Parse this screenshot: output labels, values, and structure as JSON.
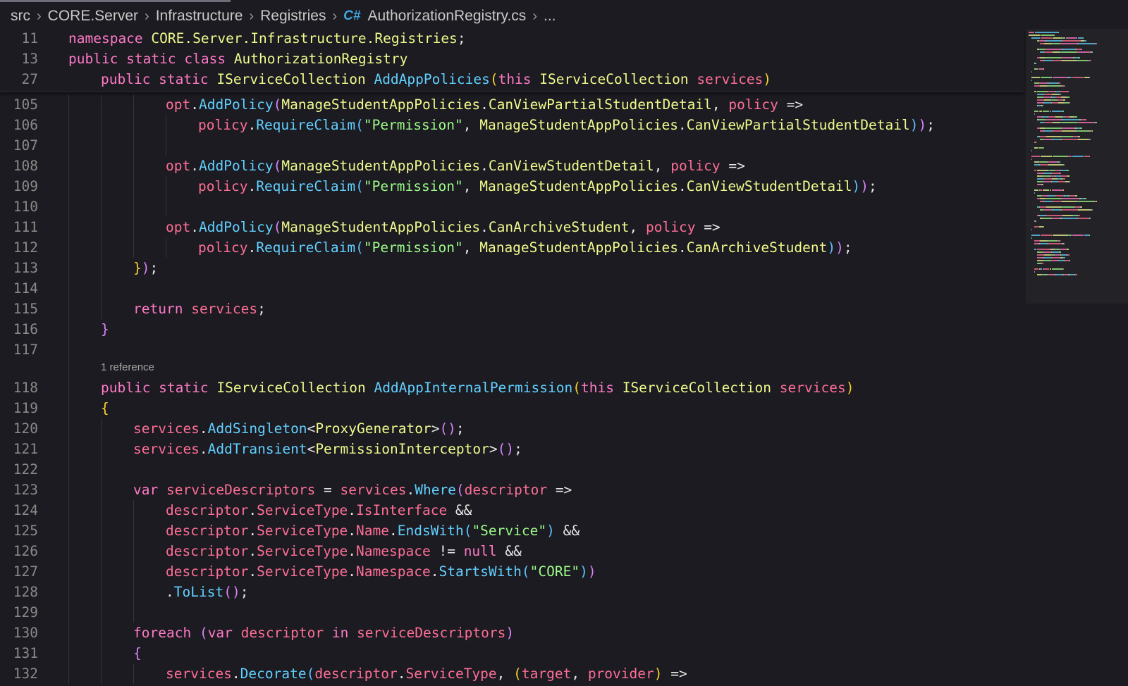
{
  "breadcrumb": {
    "items": [
      "src",
      "CORE.Server",
      "Infrastructure",
      "Registries"
    ],
    "file_icon": "C#",
    "file": "AuthorizationRegistry.cs",
    "ellipsis": "..."
  },
  "sticky": [
    {
      "ln": "11",
      "indent": 0,
      "t": [
        [
          "kw",
          "namespace"
        ],
        [
          "op",
          " "
        ],
        [
          "type",
          "CORE.Server.Infrastructure.Registries"
        ],
        [
          "op",
          ";"
        ]
      ]
    },
    {
      "ln": "13",
      "indent": 0,
      "t": [
        [
          "kw",
          "public static class"
        ],
        [
          "op",
          " "
        ],
        [
          "type",
          "AuthorizationRegistry"
        ]
      ]
    },
    {
      "ln": "27",
      "indent": 1,
      "t": [
        [
          "kw",
          "public static"
        ],
        [
          "op",
          " "
        ],
        [
          "type",
          "IServiceCollection"
        ],
        [
          "op",
          " "
        ],
        [
          "fn",
          "AddAppPolicies"
        ],
        [
          "p1",
          "("
        ],
        [
          "kw",
          "this"
        ],
        [
          "op",
          " "
        ],
        [
          "type",
          "IServiceCollection"
        ],
        [
          "op",
          " "
        ],
        [
          "var",
          "services"
        ],
        [
          "p1",
          ")"
        ]
      ]
    }
  ],
  "codelens": "1 reference",
  "lines": [
    {
      "ln": "105",
      "indent": 3,
      "t": [
        [
          "var",
          "opt"
        ],
        [
          "op",
          "."
        ],
        [
          "fn",
          "AddPolicy"
        ],
        [
          "p2",
          "("
        ],
        [
          "type",
          "ManageStudentAppPolicies"
        ],
        [
          "op",
          "."
        ],
        [
          "type",
          "CanViewPartialStudentDetail"
        ],
        [
          "op",
          ", "
        ],
        [
          "var",
          "policy"
        ],
        [
          "op",
          " =>"
        ]
      ]
    },
    {
      "ln": "106",
      "indent": 4,
      "t": [
        [
          "var",
          "policy"
        ],
        [
          "op",
          "."
        ],
        [
          "fn",
          "RequireClaim"
        ],
        [
          "p3",
          "("
        ],
        [
          "str",
          "\"Permission\""
        ],
        [
          "op",
          ", "
        ],
        [
          "type",
          "ManageStudentAppPolicies"
        ],
        [
          "op",
          "."
        ],
        [
          "type",
          "CanViewPartialStudentDetail"
        ],
        [
          "p3",
          ")"
        ],
        [
          "p2",
          ")"
        ],
        [
          "op",
          ";"
        ]
      ]
    },
    {
      "ln": "107",
      "indent": 0,
      "t": []
    },
    {
      "ln": "108",
      "indent": 3,
      "t": [
        [
          "var",
          "opt"
        ],
        [
          "op",
          "."
        ],
        [
          "fn",
          "AddPolicy"
        ],
        [
          "p2",
          "("
        ],
        [
          "type",
          "ManageStudentAppPolicies"
        ],
        [
          "op",
          "."
        ],
        [
          "type",
          "CanViewStudentDetail"
        ],
        [
          "op",
          ", "
        ],
        [
          "var",
          "policy"
        ],
        [
          "op",
          " =>"
        ]
      ]
    },
    {
      "ln": "109",
      "indent": 4,
      "t": [
        [
          "var",
          "policy"
        ],
        [
          "op",
          "."
        ],
        [
          "fn",
          "RequireClaim"
        ],
        [
          "p3",
          "("
        ],
        [
          "str",
          "\"Permission\""
        ],
        [
          "op",
          ", "
        ],
        [
          "type",
          "ManageStudentAppPolicies"
        ],
        [
          "op",
          "."
        ],
        [
          "type",
          "CanViewStudentDetail"
        ],
        [
          "p3",
          ")"
        ],
        [
          "p2",
          ")"
        ],
        [
          "op",
          ";"
        ]
      ]
    },
    {
      "ln": "110",
      "indent": 0,
      "t": []
    },
    {
      "ln": "111",
      "indent": 3,
      "t": [
        [
          "var",
          "opt"
        ],
        [
          "op",
          "."
        ],
        [
          "fn",
          "AddPolicy"
        ],
        [
          "p2",
          "("
        ],
        [
          "type",
          "ManageStudentAppPolicies"
        ],
        [
          "op",
          "."
        ],
        [
          "type",
          "CanArchiveStudent"
        ],
        [
          "op",
          ", "
        ],
        [
          "var",
          "policy"
        ],
        [
          "op",
          " =>"
        ]
      ]
    },
    {
      "ln": "112",
      "indent": 4,
      "t": [
        [
          "var",
          "policy"
        ],
        [
          "op",
          "."
        ],
        [
          "fn",
          "RequireClaim"
        ],
        [
          "p3",
          "("
        ],
        [
          "str",
          "\"Permission\""
        ],
        [
          "op",
          ", "
        ],
        [
          "type",
          "ManageStudentAppPolicies"
        ],
        [
          "op",
          "."
        ],
        [
          "type",
          "CanArchiveStudent"
        ],
        [
          "p3",
          ")"
        ],
        [
          "p2",
          ")"
        ],
        [
          "op",
          ";"
        ]
      ]
    },
    {
      "ln": "113",
      "indent": 2,
      "t": [
        [
          "p1",
          "}"
        ],
        [
          "p2",
          ")"
        ],
        [
          "op",
          ";"
        ]
      ]
    },
    {
      "ln": "114",
      "indent": 0,
      "t": []
    },
    {
      "ln": "115",
      "indent": 2,
      "t": [
        [
          "kw",
          "return"
        ],
        [
          "op",
          " "
        ],
        [
          "var",
          "services"
        ],
        [
          "op",
          ";"
        ]
      ]
    },
    {
      "ln": "116",
      "indent": 1,
      "t": [
        [
          "p2",
          "}"
        ]
      ]
    },
    {
      "ln": "117",
      "indent": 0,
      "t": []
    },
    {
      "ln": "118",
      "indent": 1,
      "codelens": true,
      "t": [
        [
          "kw",
          "public static"
        ],
        [
          "op",
          " "
        ],
        [
          "type",
          "IServiceCollection"
        ],
        [
          "op",
          " "
        ],
        [
          "fn",
          "AddAppInternalPermission"
        ],
        [
          "p1",
          "("
        ],
        [
          "kw",
          "this"
        ],
        [
          "op",
          " "
        ],
        [
          "type",
          "IServiceCollection"
        ],
        [
          "op",
          " "
        ],
        [
          "var",
          "services"
        ],
        [
          "p1",
          ")"
        ]
      ]
    },
    {
      "ln": "119",
      "indent": 1,
      "t": [
        [
          "p1",
          "{"
        ]
      ]
    },
    {
      "ln": "120",
      "indent": 2,
      "t": [
        [
          "var",
          "services"
        ],
        [
          "op",
          "."
        ],
        [
          "fn",
          "AddSingleton"
        ],
        [
          "op",
          "<"
        ],
        [
          "type",
          "ProxyGenerator"
        ],
        [
          "op",
          ">"
        ],
        [
          "p2",
          "()"
        ],
        [
          "op",
          ";"
        ]
      ]
    },
    {
      "ln": "121",
      "indent": 2,
      "t": [
        [
          "var",
          "services"
        ],
        [
          "op",
          "."
        ],
        [
          "fn",
          "AddTransient"
        ],
        [
          "op",
          "<"
        ],
        [
          "type",
          "PermissionInterceptor"
        ],
        [
          "op",
          ">"
        ],
        [
          "p2",
          "()"
        ],
        [
          "op",
          ";"
        ]
      ]
    },
    {
      "ln": "122",
      "indent": 0,
      "t": []
    },
    {
      "ln": "123",
      "indent": 2,
      "t": [
        [
          "kw",
          "var"
        ],
        [
          "op",
          " "
        ],
        [
          "var",
          "serviceDescriptors"
        ],
        [
          "op",
          " = "
        ],
        [
          "var",
          "services"
        ],
        [
          "op",
          "."
        ],
        [
          "fn",
          "Where"
        ],
        [
          "p2",
          "("
        ],
        [
          "var",
          "descriptor"
        ],
        [
          "op",
          " =>"
        ]
      ]
    },
    {
      "ln": "124",
      "indent": 3,
      "t": [
        [
          "var",
          "descriptor"
        ],
        [
          "op",
          "."
        ],
        [
          "prop",
          "ServiceType"
        ],
        [
          "op",
          "."
        ],
        [
          "prop",
          "IsInterface"
        ],
        [
          "op",
          " &&"
        ]
      ]
    },
    {
      "ln": "125",
      "indent": 3,
      "t": [
        [
          "var",
          "descriptor"
        ],
        [
          "op",
          "."
        ],
        [
          "prop",
          "ServiceType"
        ],
        [
          "op",
          "."
        ],
        [
          "prop",
          "Name"
        ],
        [
          "op",
          "."
        ],
        [
          "fn",
          "EndsWith"
        ],
        [
          "p3",
          "("
        ],
        [
          "str",
          "\"Service\""
        ],
        [
          "p3",
          ")"
        ],
        [
          "op",
          " &&"
        ]
      ]
    },
    {
      "ln": "126",
      "indent": 3,
      "t": [
        [
          "var",
          "descriptor"
        ],
        [
          "op",
          "."
        ],
        [
          "prop",
          "ServiceType"
        ],
        [
          "op",
          "."
        ],
        [
          "prop",
          "Namespace"
        ],
        [
          "op",
          " != "
        ],
        [
          "kw",
          "null"
        ],
        [
          "op",
          " &&"
        ]
      ]
    },
    {
      "ln": "127",
      "indent": 3,
      "t": [
        [
          "var",
          "descriptor"
        ],
        [
          "op",
          "."
        ],
        [
          "prop",
          "ServiceType"
        ],
        [
          "op",
          "."
        ],
        [
          "prop",
          "Namespace"
        ],
        [
          "op",
          "."
        ],
        [
          "fn",
          "StartsWith"
        ],
        [
          "p3",
          "("
        ],
        [
          "str",
          "\"CORE\""
        ],
        [
          "p3",
          ")"
        ],
        [
          "p2",
          ")"
        ]
      ]
    },
    {
      "ln": "128",
      "indent": 3,
      "t": [
        [
          "op",
          "."
        ],
        [
          "fn",
          "ToList"
        ],
        [
          "p2",
          "()"
        ],
        [
          "op",
          ";"
        ]
      ]
    },
    {
      "ln": "129",
      "indent": 0,
      "t": []
    },
    {
      "ln": "130",
      "indent": 2,
      "t": [
        [
          "kw",
          "foreach"
        ],
        [
          "op",
          " "
        ],
        [
          "p2",
          "("
        ],
        [
          "kw",
          "var"
        ],
        [
          "op",
          " "
        ],
        [
          "var",
          "descriptor"
        ],
        [
          "op",
          " "
        ],
        [
          "kw",
          "in"
        ],
        [
          "op",
          " "
        ],
        [
          "var",
          "serviceDescriptors"
        ],
        [
          "p2",
          ")"
        ]
      ]
    },
    {
      "ln": "131",
      "indent": 2,
      "t": [
        [
          "p2",
          "{"
        ]
      ]
    },
    {
      "ln": "132",
      "indent": 3,
      "t": [
        [
          "var",
          "services"
        ],
        [
          "op",
          "."
        ],
        [
          "fn",
          "Decorate"
        ],
        [
          "p3",
          "("
        ],
        [
          "var",
          "descriptor"
        ],
        [
          "op",
          "."
        ],
        [
          "prop",
          "ServiceType"
        ],
        [
          "op",
          ", "
        ],
        [
          "p1",
          "("
        ],
        [
          "var",
          "target"
        ],
        [
          "op",
          ", "
        ],
        [
          "var",
          "provider"
        ],
        [
          "p1",
          ")"
        ],
        [
          "op",
          " =>"
        ]
      ]
    }
  ],
  "colors": {
    "background": "#1b1b21",
    "keyword": "#ff79c6",
    "type": "#f1fa8c",
    "function": "#62d0ff",
    "string": "#9dfb88",
    "variable": "#ff6e96"
  }
}
